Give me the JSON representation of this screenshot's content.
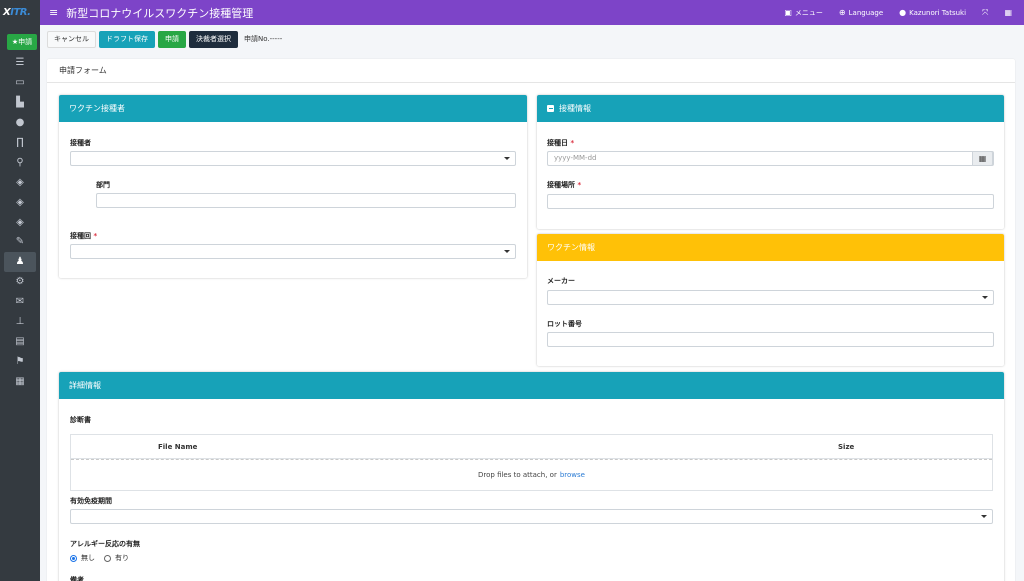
{
  "brand": {
    "logo_prefix": "X",
    "logo_text": "IT",
    "logo_suffix": "R."
  },
  "sidebar": {
    "apply_label": "★申請",
    "icons": [
      "list-icon",
      "inbox-icon",
      "chart-icon",
      "bomb-icon",
      "archway-icon",
      "pin-icon",
      "cube-icon",
      "cube-icon",
      "cube-icon",
      "edit-icon",
      "user-gear-icon",
      "gear-icon",
      "mail-icon",
      "sitemap-icon",
      "list-alt-icon",
      "flag-icon",
      "table-icon"
    ]
  },
  "topbar": {
    "menu_icon": "≡",
    "title": "新型コロナウイルスワクチン接種管理",
    "menu_label": "メニュー",
    "language_label": "Language",
    "user_label": "Kazunori Tatsuki"
  },
  "actions": {
    "cancel": "キャンセル",
    "draft": "ドラフト保存",
    "apply": "申請",
    "approver": "決裁者選択",
    "app_no": "申請No.-----"
  },
  "form": {
    "title": "申請フォーム",
    "vaccinee": {
      "header": "ワクチン接種者",
      "person_label": "接種者",
      "dept_label": "部門",
      "round_label": "接種回",
      "required_mark": "*"
    },
    "vaccination": {
      "header": "接種情報",
      "date_label": "接種日",
      "date_placeholder": "yyyy-MM-dd",
      "place_label": "接種場所",
      "required_mark": "*"
    },
    "vaccine": {
      "header": "ワクチン情報",
      "maker_label": "メーカー",
      "lot_label": "ロット番号"
    },
    "detail": {
      "header": "詳細情報",
      "certificate_label": "診断書",
      "col_filename": "File Name",
      "col_size": "Size",
      "drop_text": "Drop files to attach, or",
      "browse_link": "browse",
      "immunity_label": "有効免疫期間",
      "allergy_label": "アレルギー反応の有無",
      "allergy_no": "無し",
      "allergy_yes": "有り",
      "allergy_selected": "無し",
      "remarks_label": "備考"
    }
  }
}
